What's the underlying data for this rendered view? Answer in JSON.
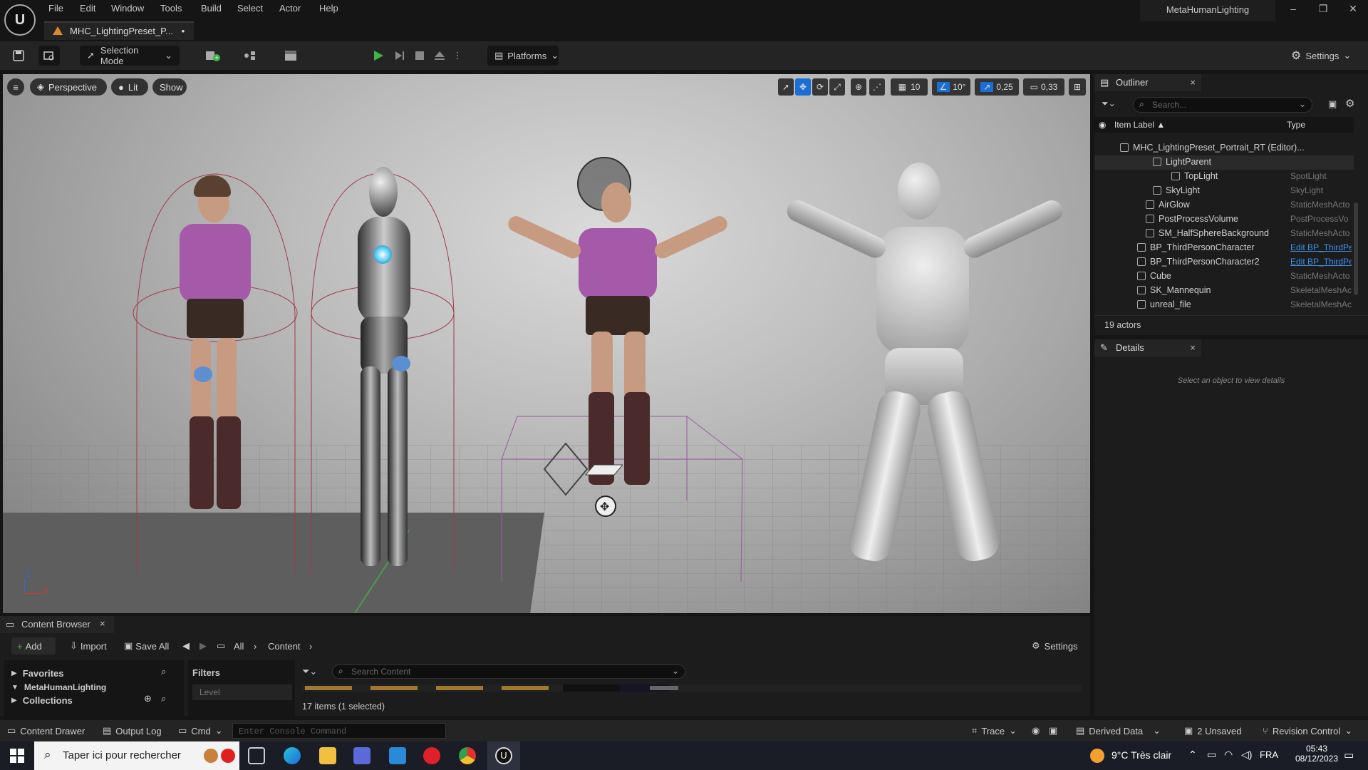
{
  "menu": {
    "items": [
      "File",
      "Edit",
      "Window",
      "Tools",
      "Build",
      "Select",
      "Actor",
      "Help"
    ],
    "project": "MetaHumanLighting",
    "window_buttons": [
      "–",
      "❐",
      "✕"
    ]
  },
  "tab": {
    "title": "MHC_LightingPreset_P...",
    "modified": "•"
  },
  "toolbar": {
    "selection_mode": "Selection Mode",
    "platforms": "Platforms",
    "settings": "Settings"
  },
  "viewport": {
    "perspective": "Perspective",
    "lit": "Lit",
    "show": "Show",
    "grid_snap": "10",
    "rotation_snap": "10°",
    "scale_snap": "0,25",
    "camera_speed": "0,33",
    "axis_z": "Z",
    "axis_x": "X"
  },
  "outliner": {
    "title": "Outliner",
    "search_placeholder": "Search...",
    "col_label": "Item Label ▲",
    "col_type": "Type",
    "rows": [
      {
        "label": "MHC_LightingPreset_Portrait_RT (Editor)...",
        "type": "",
        "indent": 54
      },
      {
        "label": "LightParent",
        "type": "",
        "indent": 100
      },
      {
        "label": "TopLight",
        "type": "SpotLight",
        "indent": 126
      },
      {
        "label": "SkyLight",
        "type": "SkyLight",
        "indent": 100
      },
      {
        "label": "AirGlow",
        "type": "StaticMeshActo",
        "indent": 90
      },
      {
        "label": "PostProcessVolume",
        "type": "PostProcessVo",
        "indent": 90
      },
      {
        "label": "SM_HalfSphereBackground",
        "type": "StaticMeshActo",
        "indent": 90
      },
      {
        "label": "BP_ThirdPersonCharacter",
        "type": "Edit BP_ThirdPe",
        "link": true,
        "indent": 78
      },
      {
        "label": "BP_ThirdPersonCharacter2",
        "type": "Edit BP_ThirdPe",
        "link": true,
        "indent": 78
      },
      {
        "label": "Cube",
        "type": "StaticMeshActo",
        "indent": 78
      },
      {
        "label": "SK_Mannequin",
        "type": "SkeletalMeshAc",
        "indent": 78
      },
      {
        "label": "unreal_file",
        "type": "SkeletalMeshAc",
        "indent": 78
      }
    ],
    "actor_count": "19 actors"
  },
  "details": {
    "title": "Details",
    "empty_text": "Select an object to view details"
  },
  "content_browser": {
    "title": "Content Browser",
    "add": "Add",
    "import": "Import",
    "save_all": "Save All",
    "path_all": "All",
    "path_content": "Content",
    "settings": "Settings",
    "favorites": "Favorites",
    "metahuman": "MetaHumanLighting",
    "collections": "Collections",
    "filters": "Filters",
    "level_filter": "Level",
    "search_placeholder": "Search Content",
    "item_count": "17 items (1 selected)"
  },
  "statusbar": {
    "content_drawer": "Content Drawer",
    "output_log": "Output Log",
    "cmd": "Cmd",
    "console_placeholder": "Enter Console Command",
    "trace": "Trace",
    "derived_data": "Derived Data",
    "unsaved": "2 Unsaved",
    "revision_control": "Revision Control"
  },
  "taskbar": {
    "search_placeholder": "Taper ici pour rechercher",
    "weather": "9°C  Très clair",
    "lang": "FRA",
    "time": "05:43",
    "date": "08/12/2023"
  },
  "colors": {
    "accent_blue": "#1a6fd6",
    "play_green": "#3db64a",
    "link_blue": "#3d8ee8"
  }
}
